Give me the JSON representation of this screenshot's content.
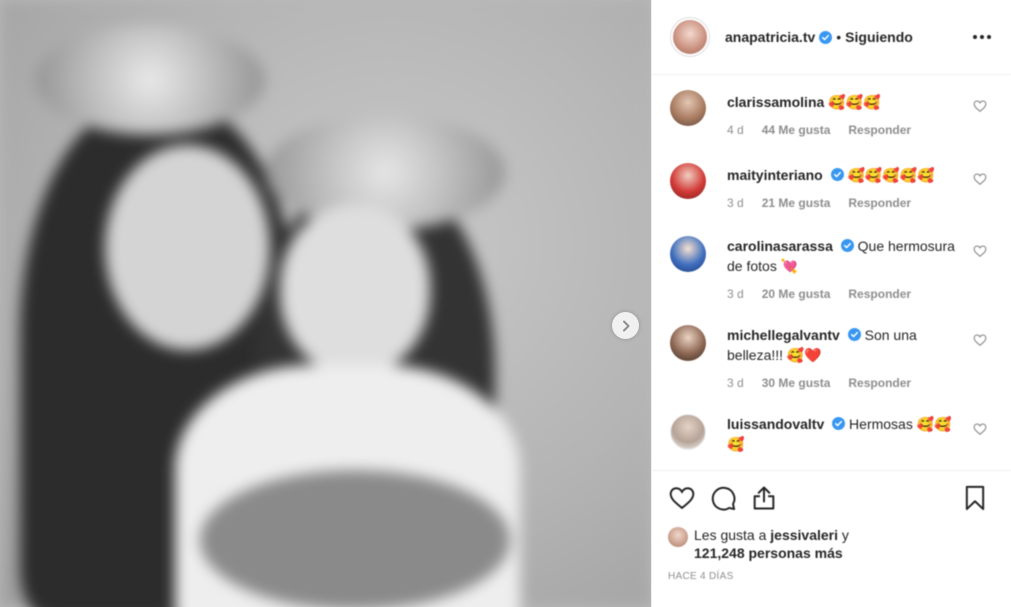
{
  "post": {
    "username": "anapatricia.tv",
    "follow_status": "Siguiendo",
    "dot": "•"
  },
  "comments": [
    {
      "username": "clarissamolina",
      "text": "🥰🥰🥰",
      "text2": "",
      "verified": false,
      "time": "4 d",
      "likes": "44 Me gusta",
      "reply": "Responder"
    },
    {
      "username": "maityinteriano",
      "text": "🥰🥰🥰🥰🥰",
      "text2": "",
      "verified": true,
      "time": "3 d",
      "likes": "21 Me gusta",
      "reply": "Responder"
    },
    {
      "username": "carolinasarassa",
      "text": "Que hermosura",
      "text2": "de fotos 💘",
      "verified": true,
      "time": "3 d",
      "likes": "20 Me gusta",
      "reply": "Responder"
    },
    {
      "username": "michellegalvantv",
      "text": "Son una",
      "text2": "belleza!!! 🥰❤️",
      "verified": true,
      "time": "3 d",
      "likes": "30 Me gusta",
      "reply": "Responder"
    },
    {
      "username": "luissandovaltv",
      "text": "Hermosas 🥰🥰",
      "text2": "🥰",
      "verified": true,
      "time": "",
      "likes": "",
      "reply": ""
    }
  ],
  "likes_summary": {
    "prefix": "Les gusta a",
    "user": "jessivaleri",
    "suffix": "y",
    "count": "121,248",
    "count_suffix": "personas más"
  },
  "date_label": "HACE 4 DÍAS",
  "colors": {
    "verified": "#3897f0",
    "text": "#262626",
    "muted": "#8e8e8e"
  },
  "icons": [
    "heart-icon",
    "comment-icon",
    "share-icon",
    "bookmark-icon",
    "chevron-right-icon",
    "more-icon",
    "verified-icon"
  ]
}
